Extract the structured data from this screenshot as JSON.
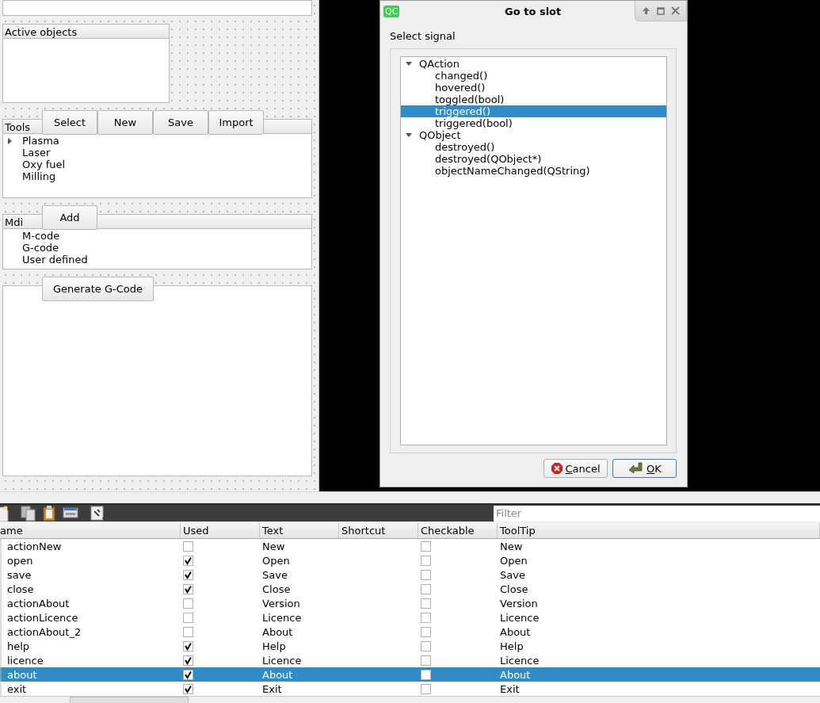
{
  "designer": {
    "active_objects": {
      "title": "Active objects"
    },
    "tools": {
      "title": "Tools",
      "buttons": [
        "Select",
        "New",
        "Save",
        "Import"
      ],
      "items": [
        {
          "label": "Plasma",
          "expandable": true
        },
        {
          "label": "Laser",
          "expandable": false
        },
        {
          "label": "Oxy fuel",
          "expandable": false
        },
        {
          "label": "Milling",
          "expandable": false
        }
      ]
    },
    "mdi": {
      "title": "Mdi",
      "buttons": [
        "Add"
      ],
      "items": [
        {
          "label": "M-code",
          "expandable": false
        },
        {
          "label": "G-code",
          "expandable": false
        },
        {
          "label": "User defined",
          "expandable": false
        }
      ]
    },
    "output": {
      "buttons": [
        "Generate G-Code"
      ]
    }
  },
  "dialog": {
    "logo": "QC",
    "title": "Go to slot",
    "label": "Select signal",
    "tree": [
      {
        "label": "QAction",
        "expanded": true,
        "children": [
          {
            "label": "changed()",
            "selected": false
          },
          {
            "label": "hovered()",
            "selected": false
          },
          {
            "label": "toggled(bool)",
            "selected": false
          },
          {
            "label": "triggered()",
            "selected": true
          },
          {
            "label": "triggered(bool)",
            "selected": false
          }
        ]
      },
      {
        "label": "QObject",
        "expanded": true,
        "children": [
          {
            "label": "destroyed()",
            "selected": false
          },
          {
            "label": "destroyed(QObject*)",
            "selected": false
          },
          {
            "label": "objectNameChanged(QString)",
            "selected": false
          }
        ]
      }
    ],
    "buttons": [
      {
        "kind": "cancel",
        "label": "Cancel",
        "mnemonic_underlined": true,
        "default": false
      },
      {
        "kind": "ok",
        "label": "OK",
        "mnemonic_underlined": true,
        "default": true
      }
    ]
  },
  "action_editor": {
    "filter": {
      "placeholder": "Filter"
    },
    "columns": [
      "ame",
      "Used",
      "Text",
      "Shortcut",
      "Checkable",
      "ToolTip"
    ],
    "rows": [
      {
        "name": "actionNew",
        "used": false,
        "text": "New",
        "checkable": false,
        "tooltip": "New",
        "selected": false
      },
      {
        "name": "open",
        "used": true,
        "text": "Open",
        "checkable": false,
        "tooltip": "Open",
        "selected": false
      },
      {
        "name": "save",
        "used": true,
        "text": "Save",
        "checkable": false,
        "tooltip": "Save",
        "selected": false
      },
      {
        "name": "close",
        "used": true,
        "text": "Close",
        "checkable": false,
        "tooltip": "Close",
        "selected": false
      },
      {
        "name": "actionAbout",
        "used": false,
        "text": "Version",
        "checkable": false,
        "tooltip": "Version",
        "selected": false
      },
      {
        "name": "actionLicence",
        "used": false,
        "text": "Licence",
        "checkable": false,
        "tooltip": "Licence",
        "selected": false
      },
      {
        "name": "actionAbout_2",
        "used": false,
        "text": "About",
        "checkable": false,
        "tooltip": "About",
        "selected": false
      },
      {
        "name": "help",
        "used": true,
        "text": "Help",
        "checkable": false,
        "tooltip": "Help",
        "selected": false
      },
      {
        "name": "licence",
        "used": true,
        "text": "Licence",
        "checkable": false,
        "tooltip": "Licence",
        "selected": false
      },
      {
        "name": "about",
        "used": true,
        "text": "About",
        "checkable": false,
        "tooltip": "About",
        "selected": true
      },
      {
        "name": "exit",
        "used": true,
        "text": "Exit",
        "checkable": false,
        "tooltip": "Exit",
        "selected": false
      }
    ]
  }
}
